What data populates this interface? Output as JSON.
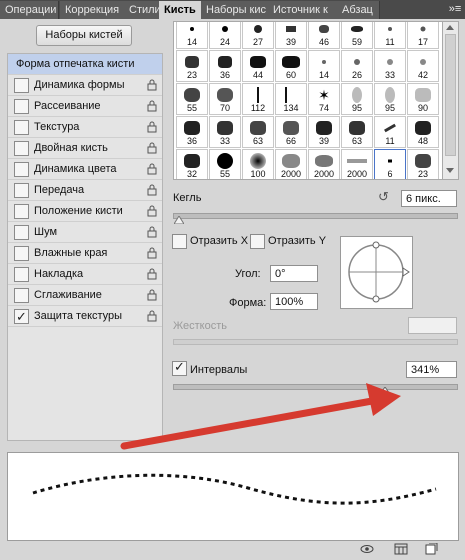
{
  "tabs": [
    "Операции",
    "Коррекция",
    "Стили",
    "Кисть",
    "Наборы кис",
    "Источник к",
    "Абзац"
  ],
  "active_tab": "Кисть",
  "menu_glyph": "»≡",
  "presets_button": "Наборы кистей",
  "settings": [
    {
      "label": "Форма отпечатка кисти",
      "selected": true,
      "checked": false,
      "lock": false
    },
    {
      "label": "Динамика формы",
      "checked": false,
      "lock": true
    },
    {
      "label": "Рассеивание",
      "checked": false,
      "lock": true
    },
    {
      "label": "Текстура",
      "checked": false,
      "lock": true
    },
    {
      "label": "Двойная кисть",
      "checked": false,
      "lock": true
    },
    {
      "label": "Динамика цвета",
      "checked": false,
      "lock": true
    },
    {
      "label": "Передача",
      "checked": false,
      "lock": true
    },
    {
      "label": "Положение кисти",
      "checked": false,
      "lock": true
    },
    {
      "label": "Шум",
      "checked": false,
      "lock": true
    },
    {
      "label": "Влажные края",
      "checked": false,
      "lock": true
    },
    {
      "label": "Накладка",
      "checked": false,
      "lock": true
    },
    {
      "label": "Сглаживание",
      "checked": false,
      "lock": true
    },
    {
      "label": "Защита текстуры",
      "checked": true,
      "lock": true
    }
  ],
  "brushes": [
    [
      "14",
      "24",
      "27",
      "39",
      "46",
      "59",
      "11",
      "17"
    ],
    [
      "23",
      "36",
      "44",
      "60",
      "14",
      "26",
      "33",
      "42"
    ],
    [
      "55",
      "70",
      "112",
      "134",
      "74",
      "95",
      "95",
      "90"
    ],
    [
      "36",
      "33",
      "63",
      "66",
      "39",
      "63",
      "11",
      "48"
    ],
    [
      "32",
      "55",
      "100",
      "2000",
      "2000",
      "2000",
      "6",
      "23"
    ]
  ],
  "size": {
    "label": "Кегль",
    "value": "6 пикс.",
    "reset_glyph": "↺"
  },
  "flip_x": {
    "label": "Отразить X",
    "checked": false
  },
  "flip_y": {
    "label": "Отразить Y",
    "checked": false
  },
  "angle": {
    "label": "Угол:",
    "value": "0°"
  },
  "roundness": {
    "label": "Форма:",
    "value": "100%"
  },
  "hardness": {
    "label": "Жесткость",
    "value": ""
  },
  "spacing": {
    "label": "Интервалы",
    "checked": true,
    "value": "341%",
    "level": 0.75
  },
  "colors": {
    "arrow": "#d63a2f",
    "selection": "#c0d0ec",
    "panel": "#d6d6d6"
  }
}
